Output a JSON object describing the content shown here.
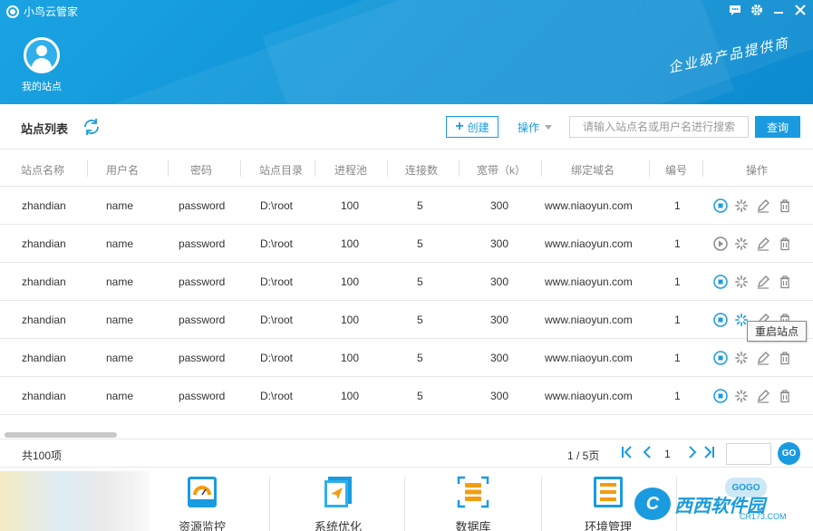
{
  "window": {
    "title": "小鸟云管家",
    "controls": [
      {
        "name": "chat-icon",
        "glyph": "💬"
      },
      {
        "name": "gear-icon",
        "glyph": "⚙"
      },
      {
        "name": "minimize-icon",
        "glyph": "—"
      },
      {
        "name": "close-icon",
        "glyph": "✕"
      }
    ]
  },
  "header": {
    "my_site_label": "我的站点",
    "slogan": "企业级产品提供商"
  },
  "toolbar": {
    "title": "站点列表",
    "create_label": "创建",
    "operation_label": "操作",
    "search_placeholder": "请输入站点名或用户名进行搜索",
    "search_button": "查询"
  },
  "table": {
    "columns": [
      "站点名称",
      "用户名",
      "密码",
      "站点目录",
      "进程池",
      "连接数",
      "宽带（k）",
      "绑定域名",
      "编号",
      "操作"
    ],
    "rows": [
      {
        "site": "zhandian",
        "user": "name",
        "password": "password",
        "dir": "D:\\root",
        "pool": "100",
        "conn": "5",
        "bandwidth": "300",
        "domain": "www.niaoyun.com",
        "id": "1",
        "status": "running"
      },
      {
        "site": "zhandian",
        "user": "name",
        "password": "password",
        "dir": "D:\\root",
        "pool": "100",
        "conn": "5",
        "bandwidth": "300",
        "domain": "www.niaoyun.com",
        "id": "1",
        "status": "stopped"
      },
      {
        "site": "zhandian",
        "user": "name",
        "password": "password",
        "dir": "D:\\root",
        "pool": "100",
        "conn": "5",
        "bandwidth": "300",
        "domain": "www.niaoyun.com",
        "id": "1",
        "status": "running"
      },
      {
        "site": "zhandian",
        "user": "name",
        "password": "password",
        "dir": "D:\\root",
        "pool": "100",
        "conn": "5",
        "bandwidth": "300",
        "domain": "www.niaoyun.com",
        "id": "1",
        "status": "running"
      },
      {
        "site": "zhandian",
        "user": "name",
        "password": "password",
        "dir": "D:\\root",
        "pool": "100",
        "conn": "5",
        "bandwidth": "300",
        "domain": "www.niaoyun.com",
        "id": "1",
        "status": "running"
      },
      {
        "site": "zhandian",
        "user": "name",
        "password": "password",
        "dir": "D:\\root",
        "pool": "100",
        "conn": "5",
        "bandwidth": "300",
        "domain": "www.niaoyun.com",
        "id": "1",
        "status": "running"
      }
    ],
    "tooltip": "重启站点"
  },
  "pagination": {
    "total": "共100项",
    "page_info": "1 / 5页",
    "current_page": "1",
    "go_label": "GO"
  },
  "dock": {
    "items": [
      {
        "label": "资源监控",
        "icon": "gauge-icon"
      },
      {
        "label": "系统优化",
        "icon": "optimize-icon"
      },
      {
        "label": "数据库",
        "icon": "database-icon"
      },
      {
        "label": "环境管理",
        "icon": "environment-icon"
      }
    ]
  },
  "watermark": {
    "text": "西西软件园",
    "url": "CR173.COM",
    "gogo": "GOGO"
  },
  "colors": {
    "accent": "#1a9be0",
    "header": "#1196d8"
  }
}
